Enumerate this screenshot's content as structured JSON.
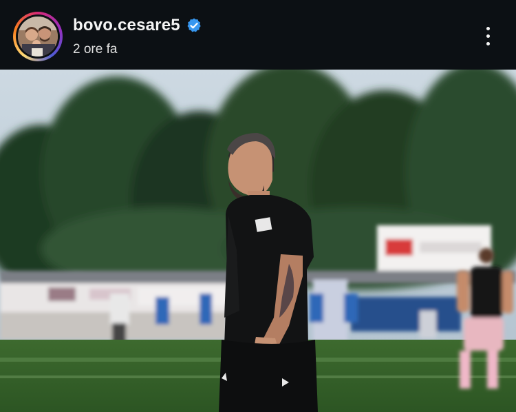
{
  "post": {
    "username": "bovo.cesare5",
    "verified_icon": "verified-badge-icon",
    "timestamp": "2 ore fa",
    "more_icon": "more-options-icon"
  },
  "colors": {
    "background": "#0c1014",
    "verified": "#3797f0",
    "text": "#f5f5f5"
  }
}
